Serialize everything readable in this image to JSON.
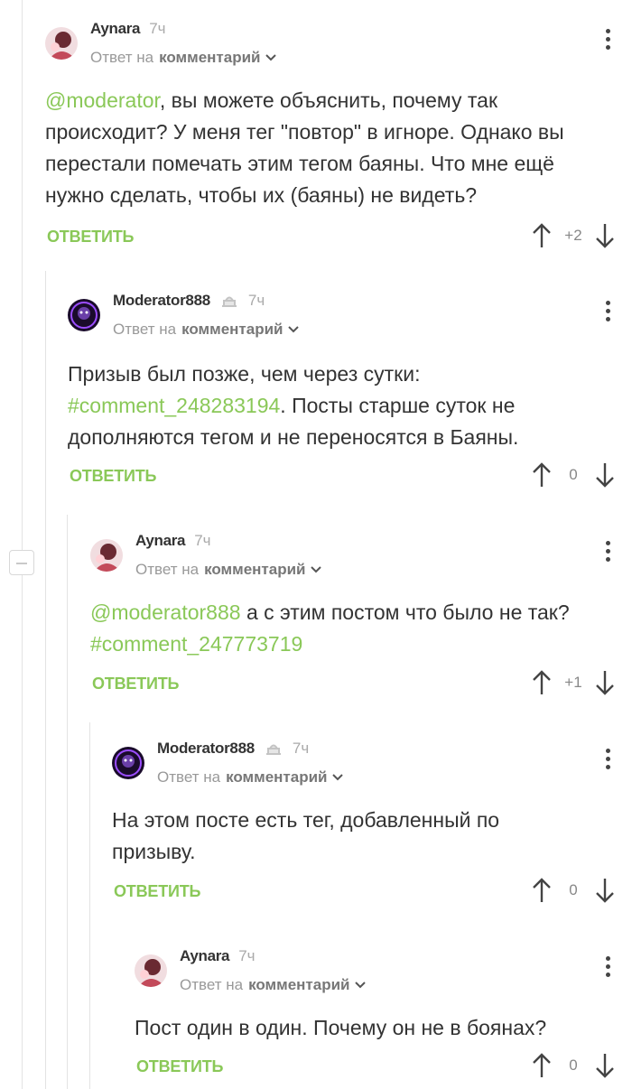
{
  "comments": [
    {
      "author": "Aynara",
      "time": "7ч",
      "reply_prefix": "Ответ на",
      "reply_target": "комментарий",
      "lines": [
        [
          {
            "t": "@moderator",
            "link": true
          },
          {
            "t": ", вы можете объяснить, почему так"
          }
        ],
        [
          {
            "t": "происходит? У меня тег \"повтор\" в игноре. Однако вы"
          }
        ],
        [
          {
            "t": "перестали помечать этим тегом баяны. Что мне ещё"
          }
        ],
        [
          {
            "t": "нужно сделать, чтобы их (баяны) не видеть?"
          }
        ]
      ],
      "reply_label": "ОТВЕТИТЬ",
      "score": "+2"
    },
    {
      "author": "Moderator888",
      "time": "7ч",
      "reply_prefix": "Ответ на",
      "reply_target": "комментарий",
      "lines": [
        [
          {
            "t": "Призыв был позже, чем через сутки:"
          }
        ],
        [
          {
            "t": "#comment_248283194",
            "link": true
          },
          {
            "t": ". Посты старше суток не"
          }
        ],
        [
          {
            "t": "дополняются тегом и не переносятся в Баяны."
          }
        ]
      ],
      "reply_label": "ОТВЕТИТЬ",
      "score": "0"
    },
    {
      "author": "Aynara",
      "time": "7ч",
      "reply_prefix": "Ответ на",
      "reply_target": "комментарий",
      "lines": [
        [
          {
            "t": "@moderator888",
            "link": true
          },
          {
            "t": " а с этим постом что было не так?"
          }
        ],
        [
          {
            "t": "#comment_247773719",
            "link": true
          }
        ]
      ],
      "reply_label": "ОТВЕТИТЬ",
      "score": "+1"
    },
    {
      "author": "Moderator888",
      "time": "7ч",
      "reply_prefix": "Ответ на",
      "reply_target": "комментарий",
      "lines": [
        [
          {
            "t": "На этом посте есть тег, добавленный по"
          }
        ],
        [
          {
            "t": "призыву."
          }
        ]
      ],
      "reply_label": "ОТВЕТИТЬ",
      "score": "0"
    },
    {
      "author": "Aynara",
      "time": "7ч",
      "reply_prefix": "Ответ на",
      "reply_target": "комментарий",
      "lines": [
        [
          {
            "t": "Пост один в один. Почему он не в боянах?"
          }
        ]
      ],
      "reply_label": "ОТВЕТИТЬ",
      "score": "0"
    }
  ],
  "colors": {
    "link": "#8ac858",
    "text": "#333333",
    "meta": "#999999"
  }
}
